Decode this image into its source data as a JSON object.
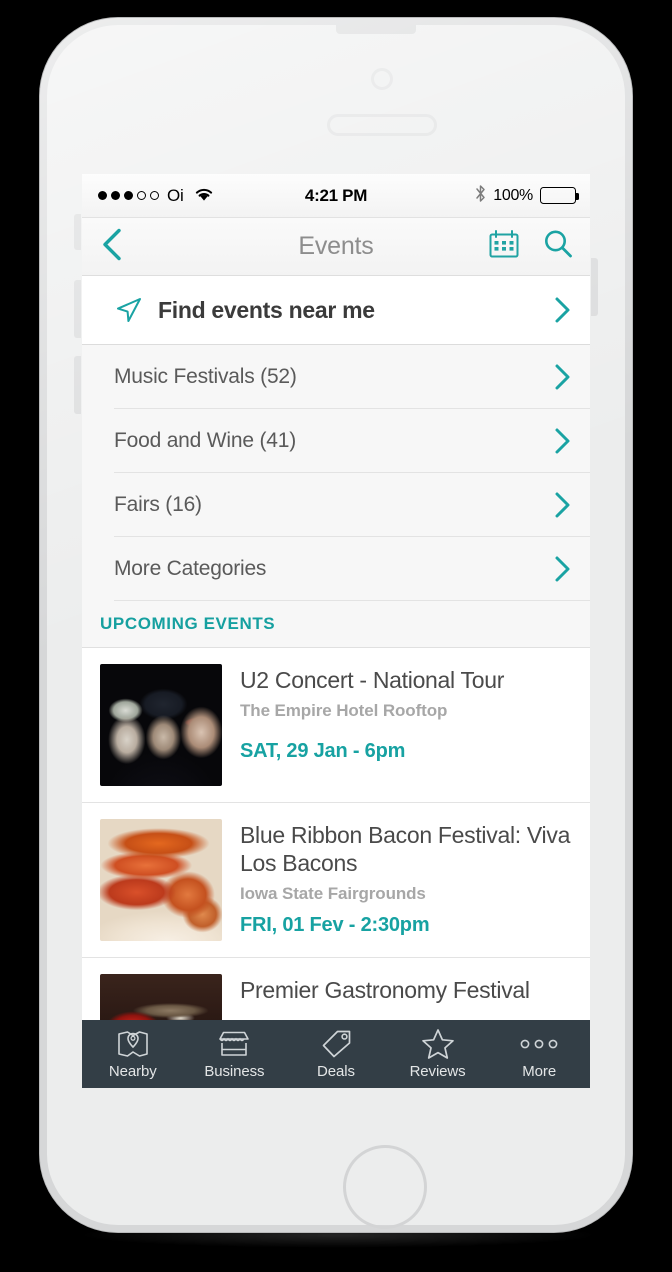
{
  "status_bar": {
    "signal_filled": 3,
    "signal_empty": 2,
    "carrier": "Oi",
    "wifi_icon": "wifi-icon",
    "time": "4:21 PM",
    "bluetooth_icon": "bluetooth-icon",
    "battery_percent": "100%",
    "battery_level": 100
  },
  "nav": {
    "back_icon": "back-chevron-icon",
    "title": "Events",
    "calendar_icon": "calendar-icon",
    "search_icon": "search-icon"
  },
  "near_me": {
    "icon": "navigation-arrow-icon",
    "label": "Find events near me",
    "chevron": "chevron-right-icon"
  },
  "categories": [
    {
      "label": "Music Festivals (52)",
      "chevron": "chevron-right-icon"
    },
    {
      "label": "Food and Wine (41)",
      "chevron": "chevron-right-icon"
    },
    {
      "label": "Fairs (16)",
      "chevron": "chevron-right-icon"
    },
    {
      "label": "More Categories",
      "chevron": "chevron-right-icon"
    }
  ],
  "section": {
    "title": "UPCOMING EVENTS"
  },
  "events": [
    {
      "title": "U2 Concert - National Tour",
      "venue": "The Empire Hotel Rooftop",
      "date": "SAT, 29 Jan - 6pm",
      "thumbnail": "u2-band-photo"
    },
    {
      "title": "Blue Ribbon Bacon Festival: Viva Los Bacons",
      "venue": "Iowa State Fairgrounds",
      "date": "FRI, 01 Fev - 2:30pm",
      "thumbnail": "bacon-plate-photo"
    },
    {
      "title": "Premier Gastronomy Festival",
      "venue": "",
      "date": "",
      "thumbnail": "gastronomy-photo"
    }
  ],
  "tabs": [
    {
      "label": "Nearby",
      "icon": "map-pin-icon"
    },
    {
      "label": "Business",
      "icon": "storefront-icon"
    },
    {
      "label": "Deals",
      "icon": "price-tag-icon"
    },
    {
      "label": "Reviews",
      "icon": "star-icon"
    },
    {
      "label": "More",
      "icon": "ellipsis-icon"
    }
  ],
  "colors": {
    "accent_teal": "#17a2a2",
    "tabbar_bg": "#333e46",
    "list_bg": "#f7f7f7",
    "card_bg": "#ffffff",
    "title_gray": "#4a4a4a",
    "venue_gray": "#a7a7a7"
  }
}
